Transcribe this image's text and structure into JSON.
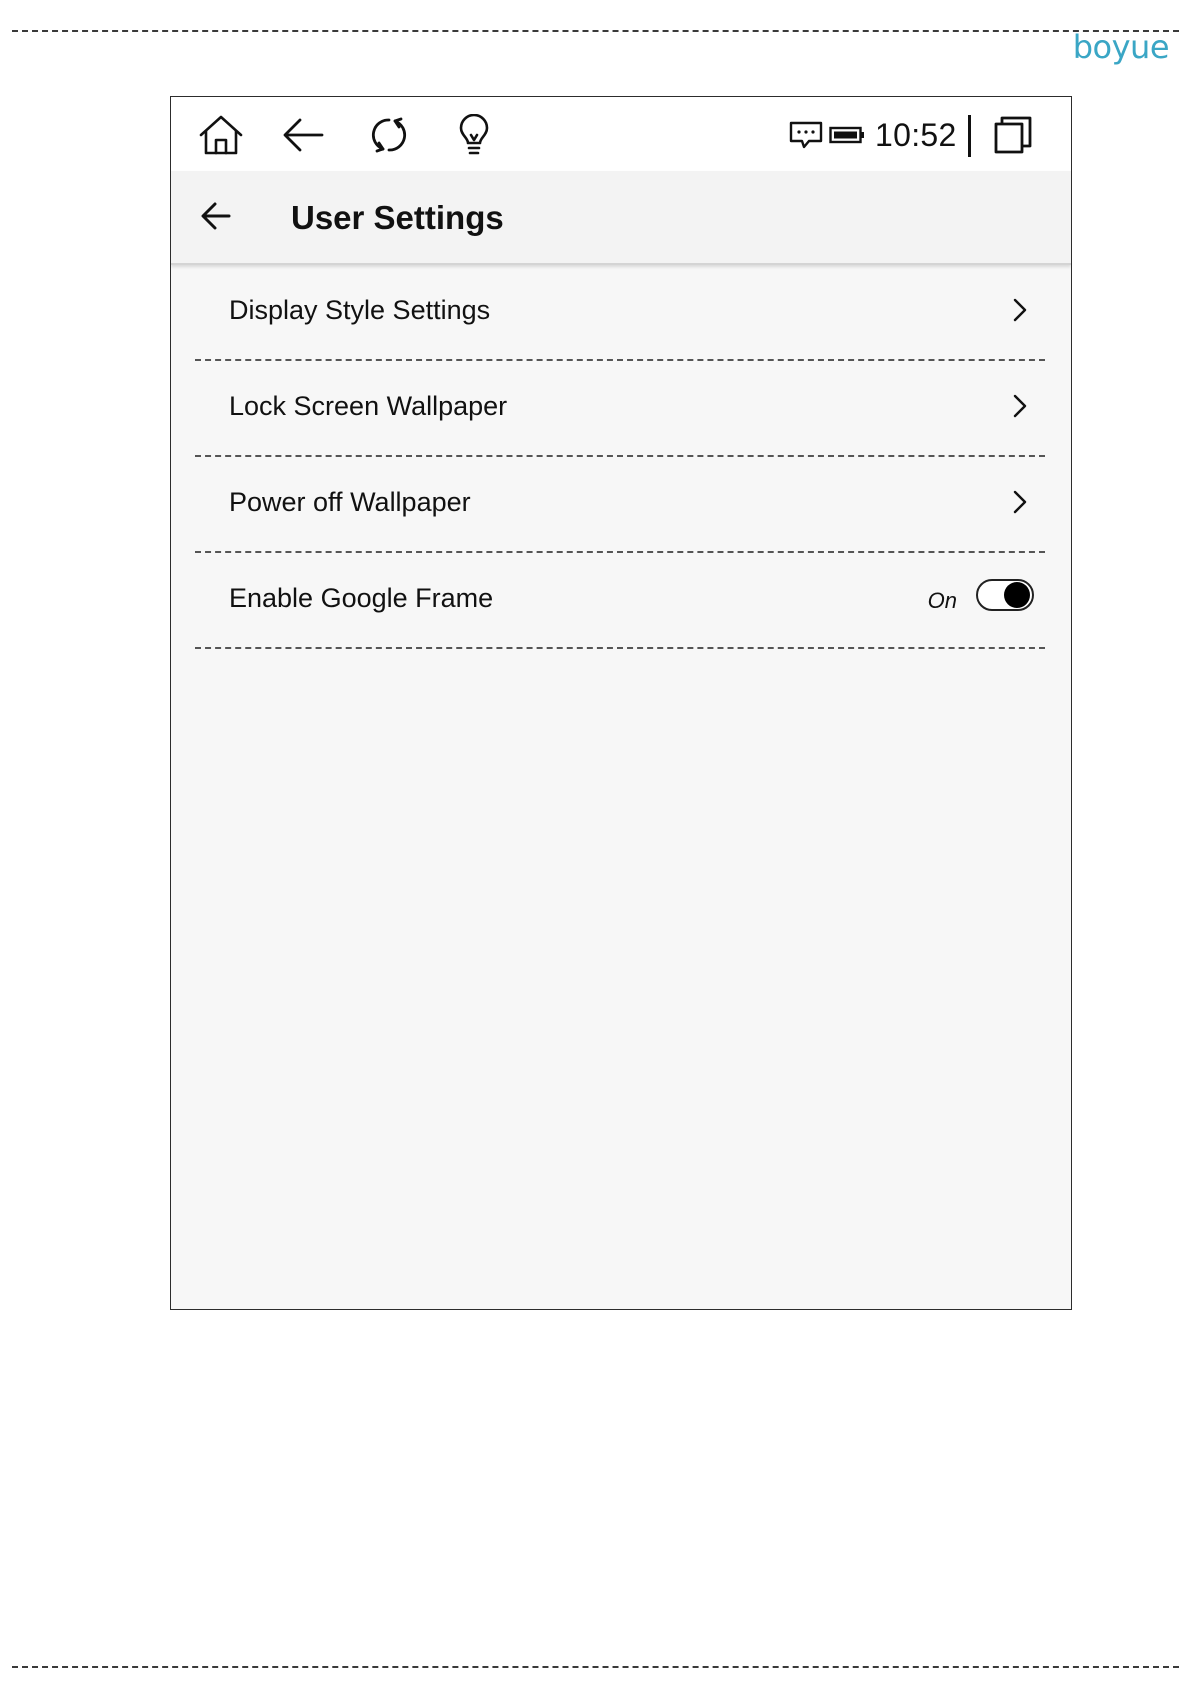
{
  "document": {
    "brand_logo_text": "boyue"
  },
  "status_bar": {
    "icons": [
      "home-icon",
      "back-arrow-icon",
      "refresh-icon",
      "lightbulb-icon",
      "message-icon",
      "battery-icon",
      "multiwindow-icon"
    ],
    "time": "10:52"
  },
  "header": {
    "back_icon": "back-arrow-icon",
    "title": "User Settings"
  },
  "settings": {
    "items": [
      {
        "label": "Display Style Settings",
        "type": "link"
      },
      {
        "label": "Lock Screen Wallpaper",
        "type": "link"
      },
      {
        "label": "Power off Wallpaper",
        "type": "link"
      },
      {
        "label": "Enable Google Frame",
        "type": "toggle",
        "state_text": "On",
        "enabled": true
      }
    ]
  },
  "colors": {
    "brand": "#3aa6c5",
    "screen_background": "#f7f7f7",
    "title_bar_background": "#f3f3f3",
    "text": "#111111"
  }
}
